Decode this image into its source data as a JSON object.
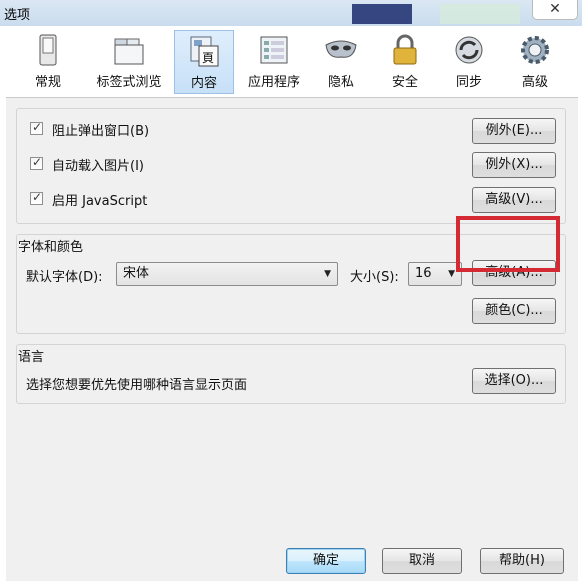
{
  "window": {
    "title": "选项",
    "close_glyph": "✕"
  },
  "toolbar": {
    "items": [
      {
        "label": "常规",
        "icon": "switch-icon"
      },
      {
        "label": "标签式浏览",
        "icon": "tabs-window-icon"
      },
      {
        "label": "内容",
        "icon": "content-page-icon",
        "active": true,
        "icon_glyph": "頁"
      },
      {
        "label": "应用程序",
        "icon": "applications-icon"
      },
      {
        "label": "隐私",
        "icon": "mask-icon"
      },
      {
        "label": "安全",
        "icon": "padlock-icon"
      },
      {
        "label": "同步",
        "icon": "sync-icon"
      },
      {
        "label": "高级",
        "icon": "gear-icon"
      }
    ]
  },
  "content": {
    "popups": {
      "label": "阻止弹出窗口(B)",
      "checked": true,
      "button": "例外(E)..."
    },
    "images": {
      "label": "自动载入图片(I)",
      "checked": true,
      "button": "例外(X)..."
    },
    "javascript": {
      "label": "启用 JavaScript",
      "checked": true,
      "button": "高级(V)..."
    }
  },
  "fonts": {
    "group_title": "字体和颜色",
    "default_font_label": "默认字体(D):",
    "default_font_value": "宋体",
    "size_label": "大小(S):",
    "size_value": "16",
    "advanced_button": "高级(A)...",
    "colors_button": "颜色(C)..."
  },
  "language": {
    "group_title": "语言",
    "description": "选择您想要优先使用哪种语言显示页面",
    "choose_button": "选择(O)..."
  },
  "footer": {
    "ok": "确定",
    "cancel": "取消",
    "help": "帮助(H)"
  },
  "colors": {
    "highlight": "#d42a34",
    "active_tab": "#c7e0f8"
  }
}
